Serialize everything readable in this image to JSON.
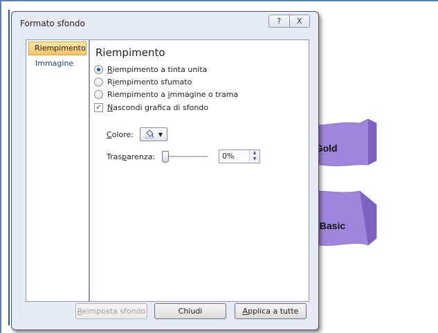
{
  "dialog": {
    "title": "Formato sfondo",
    "help_glyph": "?",
    "close_glyph": "X"
  },
  "nav": {
    "items": [
      {
        "label": "Riempimento"
      },
      {
        "label": "Immagine"
      }
    ]
  },
  "panel": {
    "heading": "Riempimento",
    "options": [
      {
        "prefix": "",
        "accel": "R",
        "rest": "iempimento a tinta unita",
        "selected": true
      },
      {
        "prefix": "",
        "accel": "i",
        "rest": "empimento sfumato",
        "selected": false
      },
      {
        "prefix": "Riempimento a ",
        "accel": "i",
        "rest": "mmagine o trama",
        "selected": false
      }
    ],
    "hide_graphics": {
      "accel": "N",
      "rest": "ascondi grafica di sfondo",
      "checked": true
    },
    "color_label": {
      "accel": "C",
      "rest": "olore:"
    },
    "transparency_label": {
      "prefix": "Tras",
      "accel": "p",
      "rest": "arenza:"
    },
    "transparency_value": "0%",
    "transparency_fraction": 0
  },
  "footer": {
    "reset_label_accel": "R",
    "reset_label_rest": "eimposta sfondo",
    "close_label": "Chiudi",
    "apply_accel": "A",
    "apply_rest": "pplica a tutte"
  },
  "slides": {
    "shape1_text": "a Gold",
    "shape2_text": "rta Basic"
  },
  "colors": {
    "shape_fill": "#9f86dc",
    "shape_dark": "#7b63bf",
    "accent_nav": "#f7c463"
  }
}
